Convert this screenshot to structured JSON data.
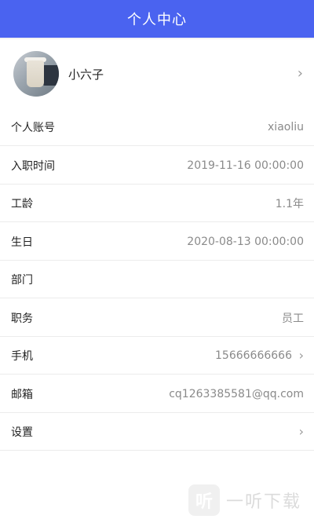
{
  "header": {
    "title": "个人中心"
  },
  "profile": {
    "name": "小六子",
    "chevron": "›"
  },
  "rows": [
    {
      "label": "个人账号",
      "value": "xiaoliu",
      "chevron": ""
    },
    {
      "label": "入职时间",
      "value": "2019-11-16 00:00:00",
      "chevron": ""
    },
    {
      "label": "工龄",
      "value": "1.1年",
      "chevron": ""
    },
    {
      "label": "生日",
      "value": "2020-08-13 00:00:00",
      "chevron": ""
    },
    {
      "label": "部门",
      "value": "",
      "chevron": ""
    },
    {
      "label": "职务",
      "value": "员工",
      "chevron": ""
    },
    {
      "label": "手机",
      "value": "15666666666",
      "chevron": "›"
    },
    {
      "label": "邮箱",
      "value": "cq1263385581@qq.com",
      "chevron": ""
    },
    {
      "label": "设置",
      "value": "",
      "chevron": "›"
    }
  ],
  "watermark": {
    "icon_glyph": "听",
    "text": "一听下载"
  },
  "colors": {
    "header_bg": "#4a63f0",
    "value_text": "#8a8a8a",
    "divider": "#ececec"
  }
}
